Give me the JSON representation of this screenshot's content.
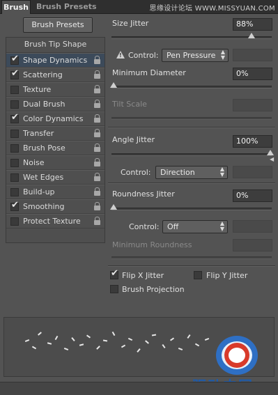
{
  "tabs": {
    "brush": "Brush",
    "presets": "Brush Presets"
  },
  "watermark": "思缘设计论坛  WWW.MISSYUAN.COM",
  "presets_button": "Brush Presets",
  "list_header": "Brush Tip Shape",
  "items": [
    {
      "label": "Shape Dynamics",
      "checked": true
    },
    {
      "label": "Scattering",
      "checked": true
    },
    {
      "label": "Texture",
      "checked": false
    },
    {
      "label": "Dual Brush",
      "checked": false
    },
    {
      "label": "Color Dynamics",
      "checked": true
    },
    {
      "label": "Transfer",
      "checked": false
    },
    {
      "label": "Brush Pose",
      "checked": false
    },
    {
      "label": "Noise",
      "checked": false
    },
    {
      "label": "Wet Edges",
      "checked": false
    },
    {
      "label": "Build-up",
      "checked": false
    },
    {
      "label": "Smoothing",
      "checked": true
    },
    {
      "label": "Protect Texture",
      "checked": false
    }
  ],
  "size_jitter": {
    "label": "Size Jitter",
    "value": "88%",
    "level": 0.88
  },
  "control1": {
    "label": "Control:",
    "value": "Pen Pressure"
  },
  "min_diameter": {
    "label": "Minimum Diameter",
    "value": "0%",
    "level": 0
  },
  "tilt_scale": {
    "label": "Tilt Scale"
  },
  "angle_jitter": {
    "label": "Angle Jitter",
    "value": "100%",
    "level": 1.0
  },
  "control2": {
    "label": "Control:",
    "value": "Direction"
  },
  "roundness_jitter": {
    "label": "Roundness Jitter",
    "value": "0%",
    "level": 0
  },
  "control3": {
    "label": "Control:",
    "value": "Off"
  },
  "min_roundness": {
    "label": "Minimum Roundness"
  },
  "flip_x": {
    "label": "Flip X Jitter",
    "checked": true
  },
  "flip_y": {
    "label": "Flip Y Jitter",
    "checked": false
  },
  "brush_projection": {
    "label": "Brush Projection",
    "checked": false
  },
  "logo_text": "驱动中国"
}
